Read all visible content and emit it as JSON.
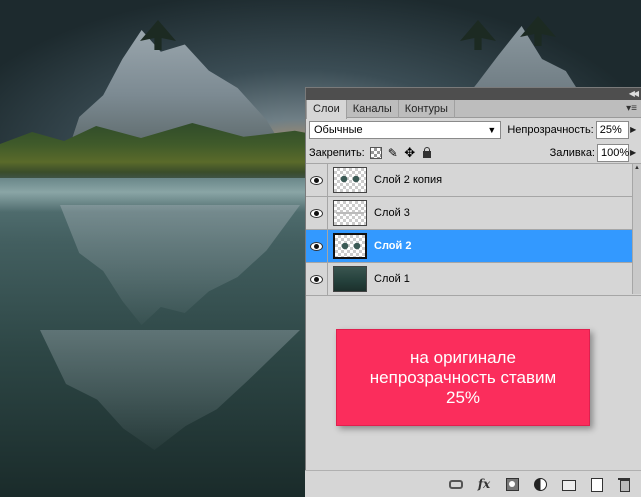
{
  "panel": {
    "tabs": [
      {
        "label": "Слои"
      },
      {
        "label": "Каналы"
      },
      {
        "label": "Контуры"
      }
    ],
    "blend_mode": "Обычные",
    "opacity_label": "Непрозрачность:",
    "opacity_value": "25%",
    "lock_label": "Закрепить:",
    "fill_label": "Заливка:",
    "fill_value": "100%"
  },
  "layers": [
    {
      "name": "Слой 2 копия",
      "visible": true,
      "selected": false,
      "thumb": "eyes"
    },
    {
      "name": "Слой 3",
      "visible": true,
      "selected": false,
      "thumb": "stripe"
    },
    {
      "name": "Слой 2",
      "visible": true,
      "selected": true,
      "thumb": "eyes"
    },
    {
      "name": "Слой 1",
      "visible": true,
      "selected": false,
      "thumb": "dark"
    }
  ],
  "note": {
    "text_line1": "на оригинале",
    "text_line2": "непрозрачность ставим",
    "text_line3": "25%"
  },
  "icons": {
    "link": "link-icon",
    "fx": "fx",
    "fx_label": "fx",
    "mask": "mask-icon",
    "adjustment": "adjustment-icon",
    "group": "folder-icon",
    "new_layer": "new-layer-icon",
    "delete": "trash-icon"
  },
  "colors": {
    "selection": "#3399ff",
    "note_bg": "#fb2d5c",
    "panel_bg": "#d6d6d6"
  }
}
